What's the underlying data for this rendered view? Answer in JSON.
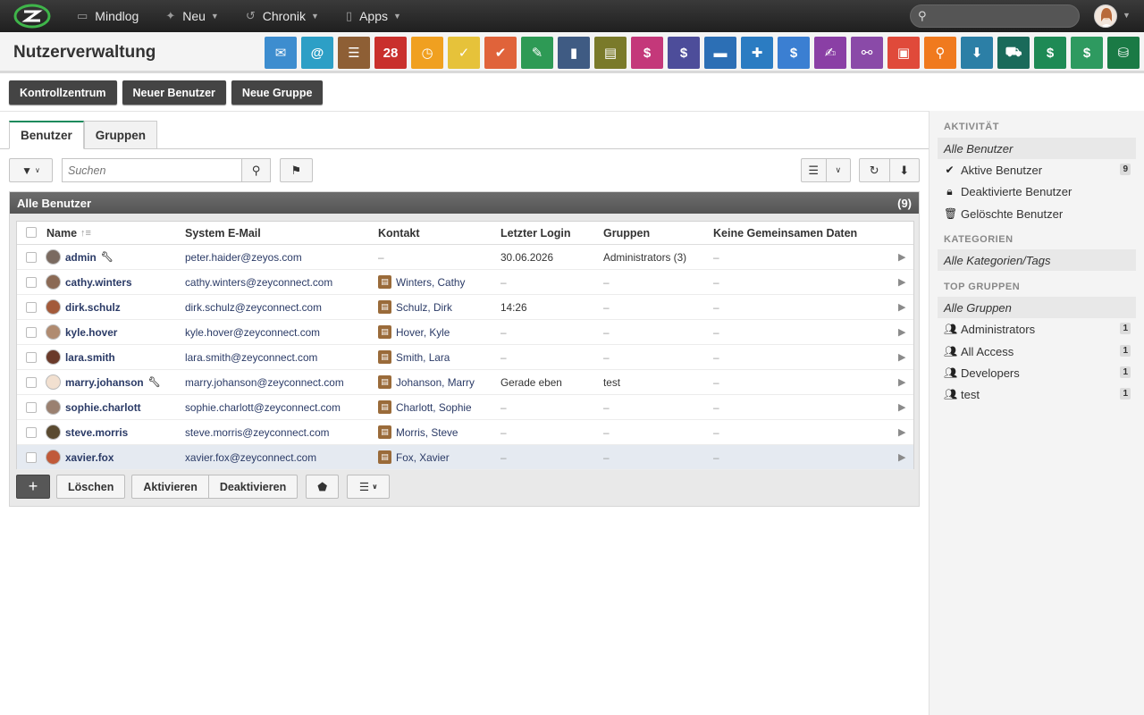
{
  "topbar": {
    "nav": [
      {
        "label": "Mindlog",
        "icon": "monitor-icon"
      },
      {
        "label": "Neu",
        "icon": "sparkle-icon"
      },
      {
        "label": "Chronik",
        "icon": "history-icon"
      },
      {
        "label": "Apps",
        "icon": "tablet-icon"
      }
    ],
    "search_placeholder": ""
  },
  "header": {
    "title": "Nutzerverwaltung"
  },
  "app_icons": [
    {
      "name": "mail-icon",
      "color": "#3d8dcf",
      "glyph": "✉"
    },
    {
      "name": "at-icon",
      "color": "#2d9fc6",
      "glyph": "@"
    },
    {
      "name": "contacts-icon",
      "color": "#8e5f35",
      "glyph": "☰"
    },
    {
      "name": "calendar-icon",
      "color": "#c9302c",
      "glyph": "28"
    },
    {
      "name": "timer-icon",
      "color": "#f0a020",
      "glyph": "◷"
    },
    {
      "name": "tasks-icon",
      "color": "#e6c23a",
      "glyph": "✓"
    },
    {
      "name": "folder-check-icon",
      "color": "#e0633a",
      "glyph": "✔"
    },
    {
      "name": "notes-icon",
      "color": "#2e9a55",
      "glyph": "✎"
    },
    {
      "name": "bookmark-icon",
      "color": "#3f5b83",
      "glyph": "▮"
    },
    {
      "name": "document-icon",
      "color": "#7a7a2a",
      "glyph": "▤"
    },
    {
      "name": "cashdesk-icon",
      "color": "#c4387a",
      "glyph": "$"
    },
    {
      "name": "dollar-icon",
      "color": "#4d4d9a",
      "glyph": "$"
    },
    {
      "name": "truck-icon",
      "color": "#2c6fb5",
      "glyph": "▬"
    },
    {
      "name": "support-icon",
      "color": "#2b7cc2",
      "glyph": "✚"
    },
    {
      "name": "moneybag-icon",
      "color": "#3b7fd2",
      "glyph": "$"
    },
    {
      "name": "contract-icon",
      "color": "#8a3fa5",
      "glyph": "✍"
    },
    {
      "name": "handshake-icon",
      "color": "#8a4aa8",
      "glyph": "⚯"
    },
    {
      "name": "pdf-icon",
      "color": "#e04a3a",
      "glyph": "▣"
    },
    {
      "name": "broadcast-icon",
      "color": "#f07a1e",
      "glyph": "⚲"
    },
    {
      "name": "download-icon",
      "color": "#2c7fa6",
      "glyph": "⬇"
    },
    {
      "name": "cart-icon",
      "color": "#1a6a5a",
      "glyph": "⛟"
    },
    {
      "name": "cash-icon",
      "color": "#1e8a55",
      "glyph": "$"
    },
    {
      "name": "pricetag-icon",
      "color": "#2e9a60",
      "glyph": "$"
    },
    {
      "name": "database-icon",
      "color": "#1a7a45",
      "glyph": "⛁"
    }
  ],
  "actions": [
    "Kontrollzentrum",
    "Neuer Benutzer",
    "Neue Gruppe"
  ],
  "tabs": [
    "Benutzer",
    "Gruppen"
  ],
  "search": {
    "placeholder": "Suchen"
  },
  "panel": {
    "title": "Alle Benutzer",
    "count": "(9)"
  },
  "columns": [
    "Name",
    "System E-Mail",
    "Kontakt",
    "Letzter Login",
    "Gruppen",
    "Keine Gemeinsamen Daten"
  ],
  "users": [
    {
      "name": "admin",
      "wrench": true,
      "email": "peter.haider@zeyos.com",
      "contact": "",
      "login": "30.06.2026",
      "groups": "Administrators (3)",
      "keine": "–",
      "avatar": "#7a6a60"
    },
    {
      "name": "cathy.winters",
      "wrench": false,
      "email": "cathy.winters@zeyconnect.com",
      "contact": "Winters, Cathy",
      "login": "–",
      "groups": "–",
      "keine": "–",
      "avatar": "#8b6a55"
    },
    {
      "name": "dirk.schulz",
      "wrench": false,
      "email": "dirk.schulz@zeyconnect.com",
      "contact": "Schulz, Dirk",
      "login": "14:26",
      "groups": "–",
      "keine": "–",
      "avatar": "#a35a3a"
    },
    {
      "name": "kyle.hover",
      "wrench": false,
      "email": "kyle.hover@zeyconnect.com",
      "contact": "Hover, Kyle",
      "login": "–",
      "groups": "–",
      "keine": "–",
      "avatar": "#b08b70"
    },
    {
      "name": "lara.smith",
      "wrench": false,
      "email": "lara.smith@zeyconnect.com",
      "contact": "Smith, Lara",
      "login": "–",
      "groups": "–",
      "keine": "–",
      "avatar": "#6a3a2a"
    },
    {
      "name": "marry.johanson",
      "wrench": true,
      "email": "marry.johanson@zeyconnect.com",
      "contact": "Johanson, Marry",
      "login": "Gerade eben",
      "groups": "test",
      "keine": "–",
      "avatar": "#f2e0d0"
    },
    {
      "name": "sophie.charlott",
      "wrench": false,
      "email": "sophie.charlott@zeyconnect.com",
      "contact": "Charlott, Sophie",
      "login": "–",
      "groups": "–",
      "keine": "–",
      "avatar": "#9a8070"
    },
    {
      "name": "steve.morris",
      "wrench": false,
      "email": "steve.morris@zeyconnect.com",
      "contact": "Morris, Steve",
      "login": "–",
      "groups": "–",
      "keine": "–",
      "avatar": "#5a4a30"
    },
    {
      "name": "xavier.fox",
      "wrench": false,
      "email": "xavier.fox@zeyconnect.com",
      "contact": "Fox, Xavier",
      "login": "–",
      "groups": "–",
      "keine": "–",
      "avatar": "#c05a3a",
      "selected": true
    }
  ],
  "bottom": {
    "delete": "Löschen",
    "activate": "Aktivieren",
    "deactivate": "Deaktivieren"
  },
  "sidebar": {
    "activity_heading": "AKTIVITÄT",
    "activity": [
      {
        "label": "Alle Benutzer",
        "count": ""
      },
      {
        "label": "Aktive Benutzer",
        "count": "9"
      },
      {
        "label": "Deaktivierte Benutzer",
        "count": ""
      },
      {
        "label": "Gelöschte Benutzer",
        "count": ""
      }
    ],
    "categories_heading": "KATEGORIEN",
    "categories_all": "Alle Kategorien/Tags",
    "groups_heading": "TOP GRUPPEN",
    "groups_all": "Alle Gruppen",
    "groups": [
      {
        "label": "Administrators",
        "count": "1"
      },
      {
        "label": "All Access",
        "count": "1"
      },
      {
        "label": "Developers",
        "count": "1"
      },
      {
        "label": "test",
        "count": "1"
      }
    ]
  }
}
